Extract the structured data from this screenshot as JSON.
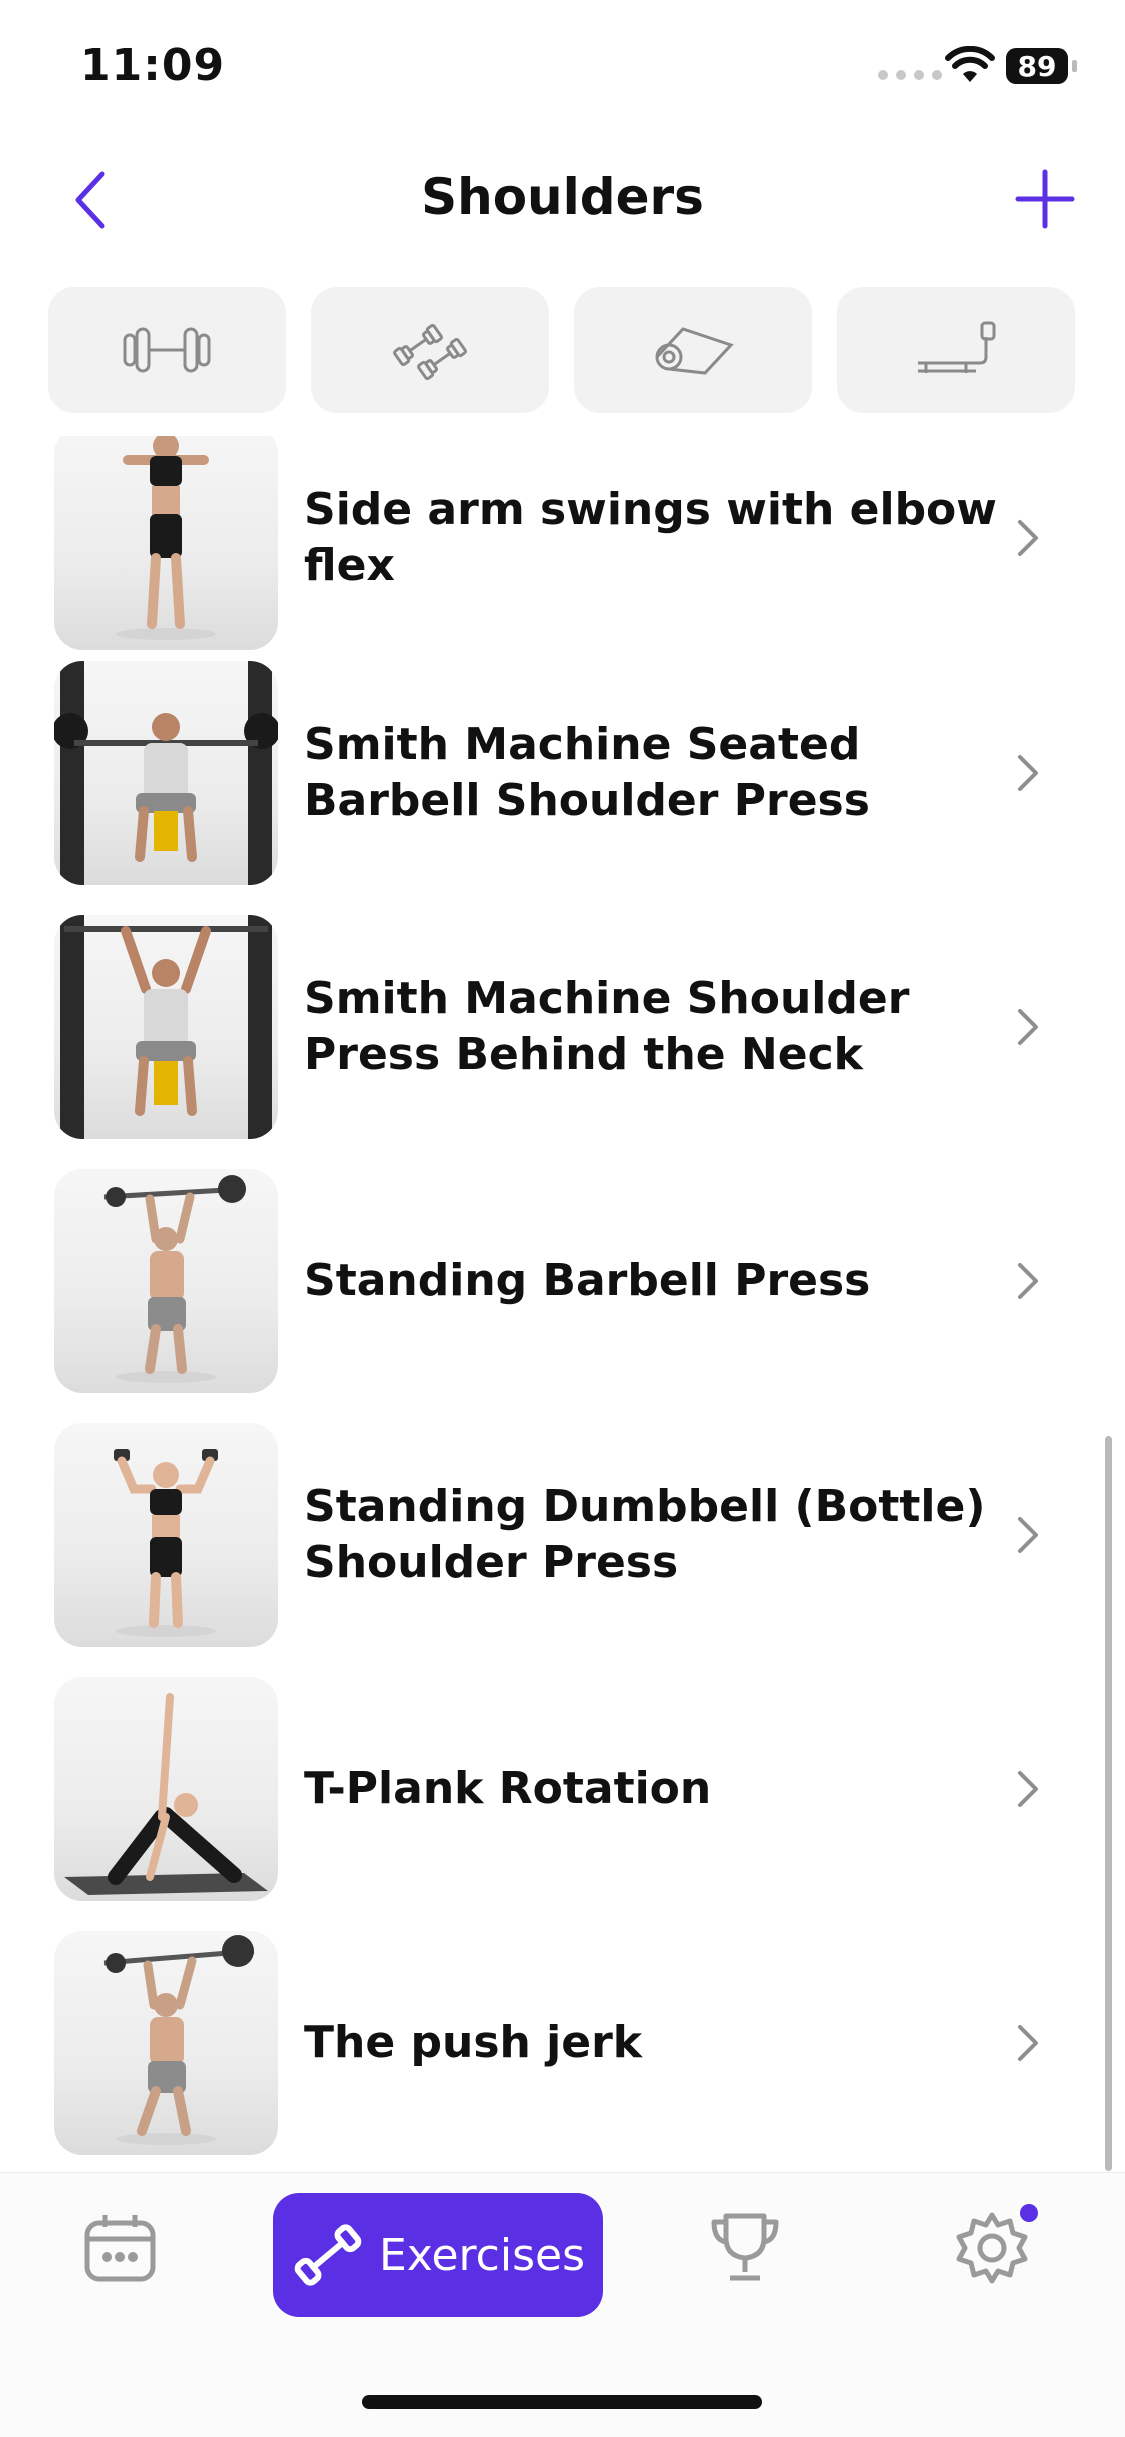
{
  "status_bar": {
    "time": "11:09",
    "battery": "89"
  },
  "nav": {
    "title": "Shoulders"
  },
  "filters": [
    {
      "icon": "barbell-icon"
    },
    {
      "icon": "dumbbells-icon"
    },
    {
      "icon": "yoga-mat-icon"
    },
    {
      "icon": "treadmill-icon"
    }
  ],
  "exercises": [
    {
      "title": "Side arm swings with elbow flex"
    },
    {
      "title": "Smith Machine Seated Barbell Shoulder Press"
    },
    {
      "title": "Smith Machine Shoulder Press Behind the Neck"
    },
    {
      "title": "Standing Barbell Press"
    },
    {
      "title": "Standing Dumbbell (Bottle) Shoulder Press"
    },
    {
      "title": "T-Plank Rotation"
    },
    {
      "title": "The push jerk"
    }
  ],
  "tabbar": {
    "exercises_label": "Exercises",
    "accent_color": "#5b2fe3"
  }
}
